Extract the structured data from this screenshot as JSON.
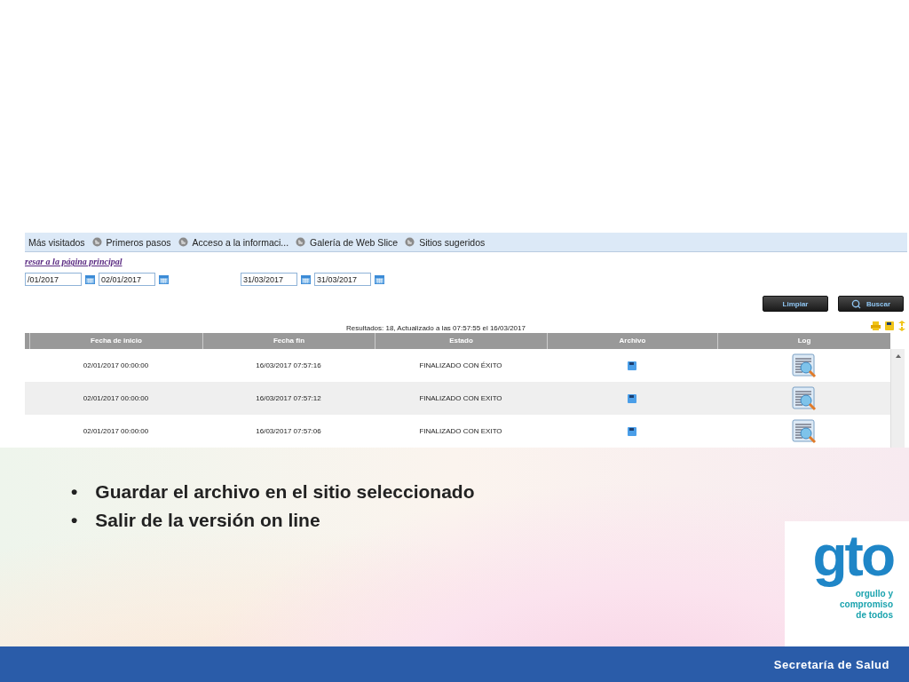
{
  "browser": {
    "favorites": [
      {
        "label": "Más visitados",
        "icon": false
      },
      {
        "label": "Primeros pasos",
        "icon": true
      },
      {
        "label": "Acceso a la informaci...",
        "icon": true
      },
      {
        "label": "Galería de Web Slice",
        "icon": true
      },
      {
        "label": "Sitios sugeridos",
        "icon": true
      }
    ]
  },
  "page": {
    "back_link": "resar a la página principal",
    "date_ranges": [
      [
        "/01/2017",
        "02/01/2017"
      ],
      [
        "31/03/2017",
        "31/03/2017"
      ]
    ],
    "buttons": [
      {
        "label": "Limpiar",
        "icon": false
      },
      {
        "label": "Buscar",
        "icon": true
      }
    ],
    "results": "Resultados: 18, Actualizado a las 07:57:55 el 16/03/2017",
    "table": {
      "columns": [
        "Fecha de inicio",
        "Fecha fin",
        "Estado",
        "Archivo",
        "Log"
      ],
      "rows": [
        {
          "start": "02/01/2017 00:00:00",
          "end": "16/03/2017 07:57:16",
          "status": "FINALIZADO CON ÉXITO"
        },
        {
          "start": "02/01/2017 00:00:00",
          "end": "16/03/2017 07:57:12",
          "status": "FINALIZADO CON EXITO"
        },
        {
          "start": "02/01/2017 00:00:00",
          "end": "16/03/2017 07:57:06",
          "status": "FINALIZADO CON EXITO"
        }
      ]
    }
  },
  "slide": {
    "bullets": [
      {
        "marker": "•",
        "text": "Guardar el archivo en el sitio seleccionado"
      },
      {
        "marker": "•",
        "text": "Salir de la versión on line"
      }
    ],
    "logo": {
      "mark": "gto",
      "tagline": [
        "orgullo y",
        "compromiso",
        "de todos"
      ]
    },
    "footer": "Secretaría de Salud"
  }
}
